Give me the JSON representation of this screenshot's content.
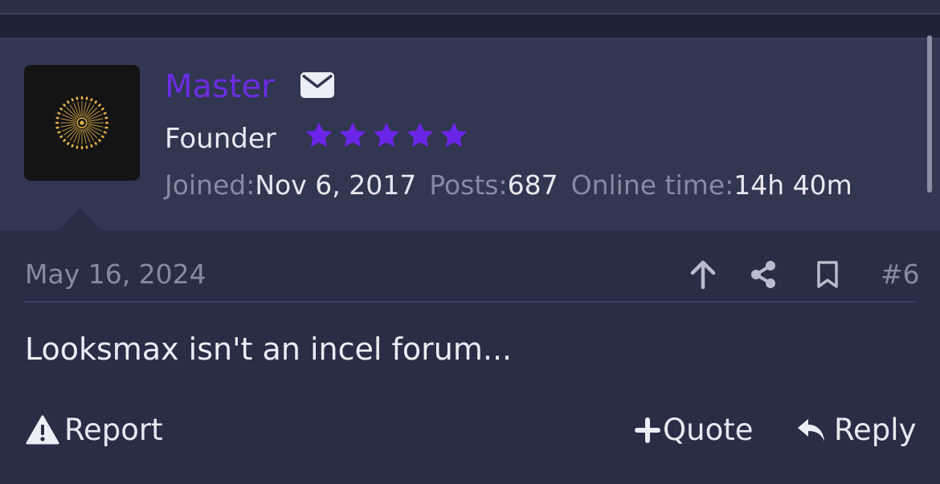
{
  "author": {
    "username": "Master",
    "title": "Founder",
    "stars": 5,
    "joined_label": "Joined:",
    "joined_value": "Nov 6, 2017",
    "posts_label": "Posts:",
    "posts_value": "687",
    "online_label": "Online time:",
    "online_value": "14h 40m"
  },
  "post": {
    "date": "May 16, 2024",
    "number": "#6",
    "body": "Looksmax isn't an incel forum..."
  },
  "actions": {
    "report": "Report",
    "quote": "Quote",
    "reply": "Reply"
  },
  "icons": {
    "mail": "envelope-icon",
    "star": "star-icon",
    "upvote": "arrow-up-icon",
    "share": "share-icon",
    "bookmark": "bookmark-icon",
    "warning": "warning-icon",
    "plus": "plus-icon",
    "reply": "reply-icon"
  },
  "colors": {
    "username": "#6b2de3",
    "stars": "#6a26e8",
    "avatar_sun": "#e6b245"
  }
}
